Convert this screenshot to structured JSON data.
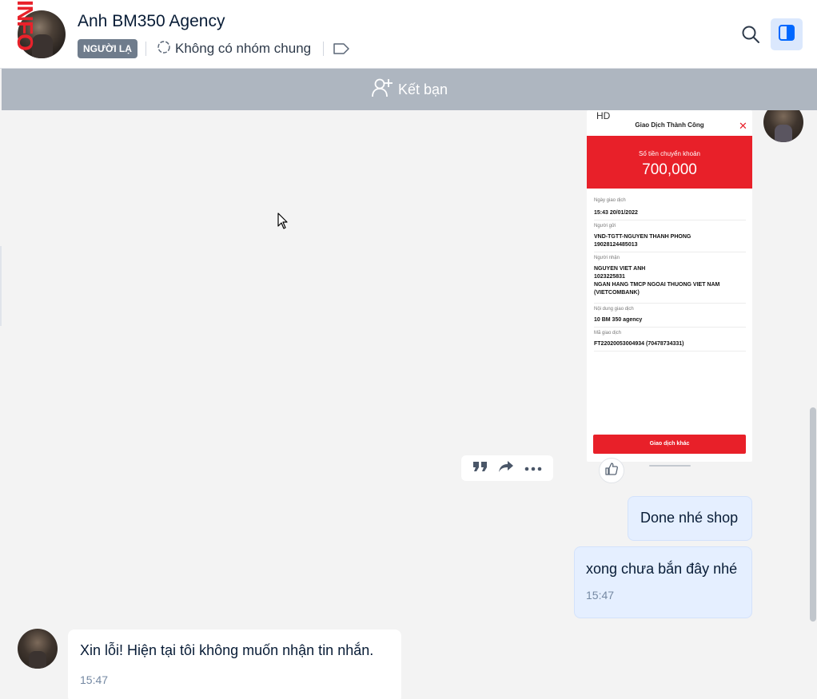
{
  "header": {
    "watermark": "INFO",
    "title": "Anh BM350 Agency",
    "badge": "NGƯỜI LẠ",
    "group_info": "Không có nhóm chung",
    "icons": {
      "group": "group-icon",
      "tag": "tag-icon",
      "search": "search-icon",
      "panel": "side-panel-icon"
    },
    "accent": "#0068ff"
  },
  "friend_bar": {
    "label": "Kết bạn",
    "icon": "add-friend-icon"
  },
  "receipt": {
    "status": "HD",
    "title": "Giao Dịch Thành Công",
    "amount_label": "Số tiền chuyển khoản",
    "amount": "700,000",
    "rows": [
      {
        "label": "Ngày giao dịch",
        "value": "15:43 20/01/2022"
      },
      {
        "label": "Người gửi",
        "value": "VND-TGTT-NGUYEN THANH PHONG\n19028124485013"
      },
      {
        "label": "Người nhận",
        "value": "NGUYEN VIET ANH\n1023225831\nNGAN HANG TMCP NGOAI THUONG VIET NAM\n(VIETCOMBANK)"
      },
      {
        "label": "Nội dung giao dịch",
        "value": "10 BM 350 agency"
      },
      {
        "label": "Mã giao dịch",
        "value": "FT22020053004934 (70478734331)"
      }
    ],
    "button": "Giao dịch khác",
    "brand_color": "#e82029"
  },
  "messages": {
    "m1": {
      "text": "Done nhé shop"
    },
    "m2": {
      "text": "xong chưa bắn đây nhé",
      "time": "15:47"
    },
    "m3": {
      "text": "Xin lỗi! Hiện tại tôi không muốn nhận tin nhắn.",
      "time": "15:47"
    }
  },
  "message_actions": [
    "quote-icon",
    "forward-icon",
    "more-icon"
  ]
}
